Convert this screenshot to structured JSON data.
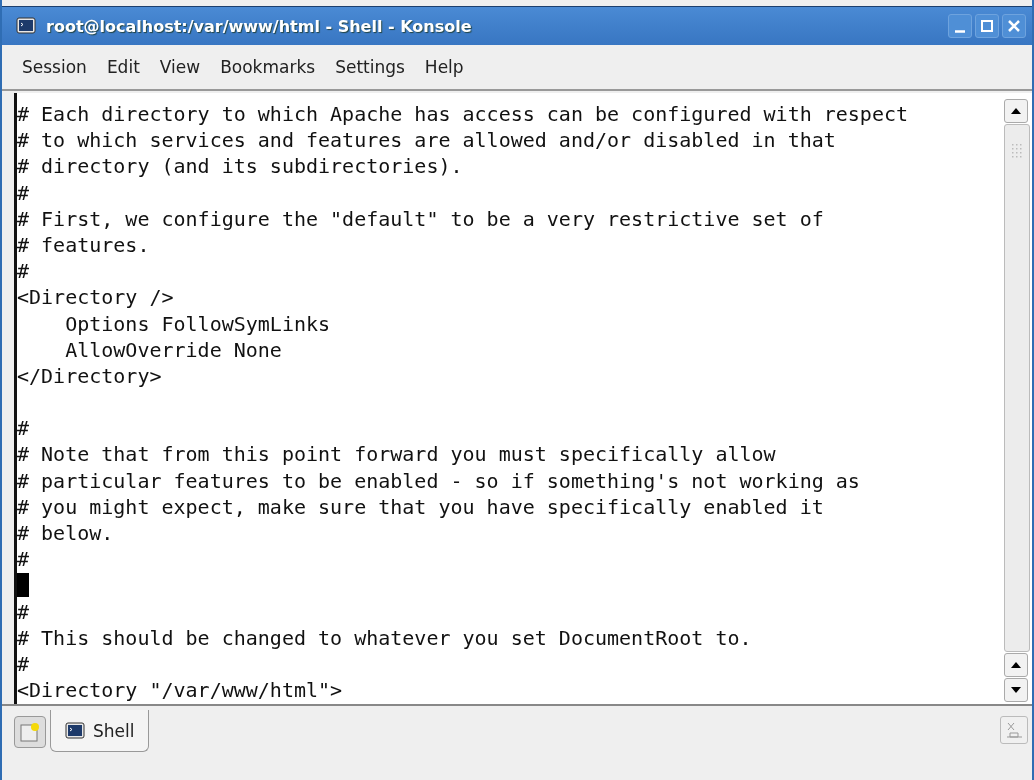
{
  "window": {
    "title": "root@localhost:/var/www/html - Shell - Konsole"
  },
  "menu": [
    "Session",
    "Edit",
    "View",
    "Bookmarks",
    "Settings",
    "Help"
  ],
  "terminal": {
    "lines": [
      {
        "text": "# Each directory to which Apache has access can be configured with respect",
        "cursor": false
      },
      {
        "text": "# to which services and features are allowed and/or disabled in that",
        "cursor": false
      },
      {
        "text": "# directory (and its subdirectories).",
        "cursor": false
      },
      {
        "text": "#",
        "cursor": false
      },
      {
        "text": "# First, we configure the \"default\" to be a very restrictive set of",
        "cursor": false
      },
      {
        "text": "# features.",
        "cursor": false
      },
      {
        "text": "#",
        "cursor": false
      },
      {
        "text": "<Directory />",
        "cursor": false
      },
      {
        "text": "    Options FollowSymLinks",
        "cursor": false
      },
      {
        "text": "    AllowOverride None",
        "cursor": false
      },
      {
        "text": "</Directory>",
        "cursor": false
      },
      {
        "cursor": false
      },
      {
        "text": "#",
        "cursor": false
      },
      {
        "text": "# Note that from this point forward you must specifically allow",
        "cursor": false
      },
      {
        "text": "# particular features to be enabled - so if something's not working as",
        "cursor": false
      },
      {
        "text": "# you might expect, make sure that you have specifically enabled it",
        "cursor": false
      },
      {
        "text": "# below.",
        "cursor": false
      },
      {
        "text": "#",
        "cursor": false
      },
      {
        "cursor": true
      },
      {
        "text": "#",
        "cursor": false
      },
      {
        "text": "# This should be changed to whatever you set DocumentRoot to.",
        "cursor": false
      },
      {
        "text": "#",
        "cursor": false
      },
      {
        "text": "<Directory \"/var/www/html\">",
        "cursor": false
      }
    ]
  },
  "tabs": [
    {
      "label": "Shell",
      "selected": true
    }
  ]
}
